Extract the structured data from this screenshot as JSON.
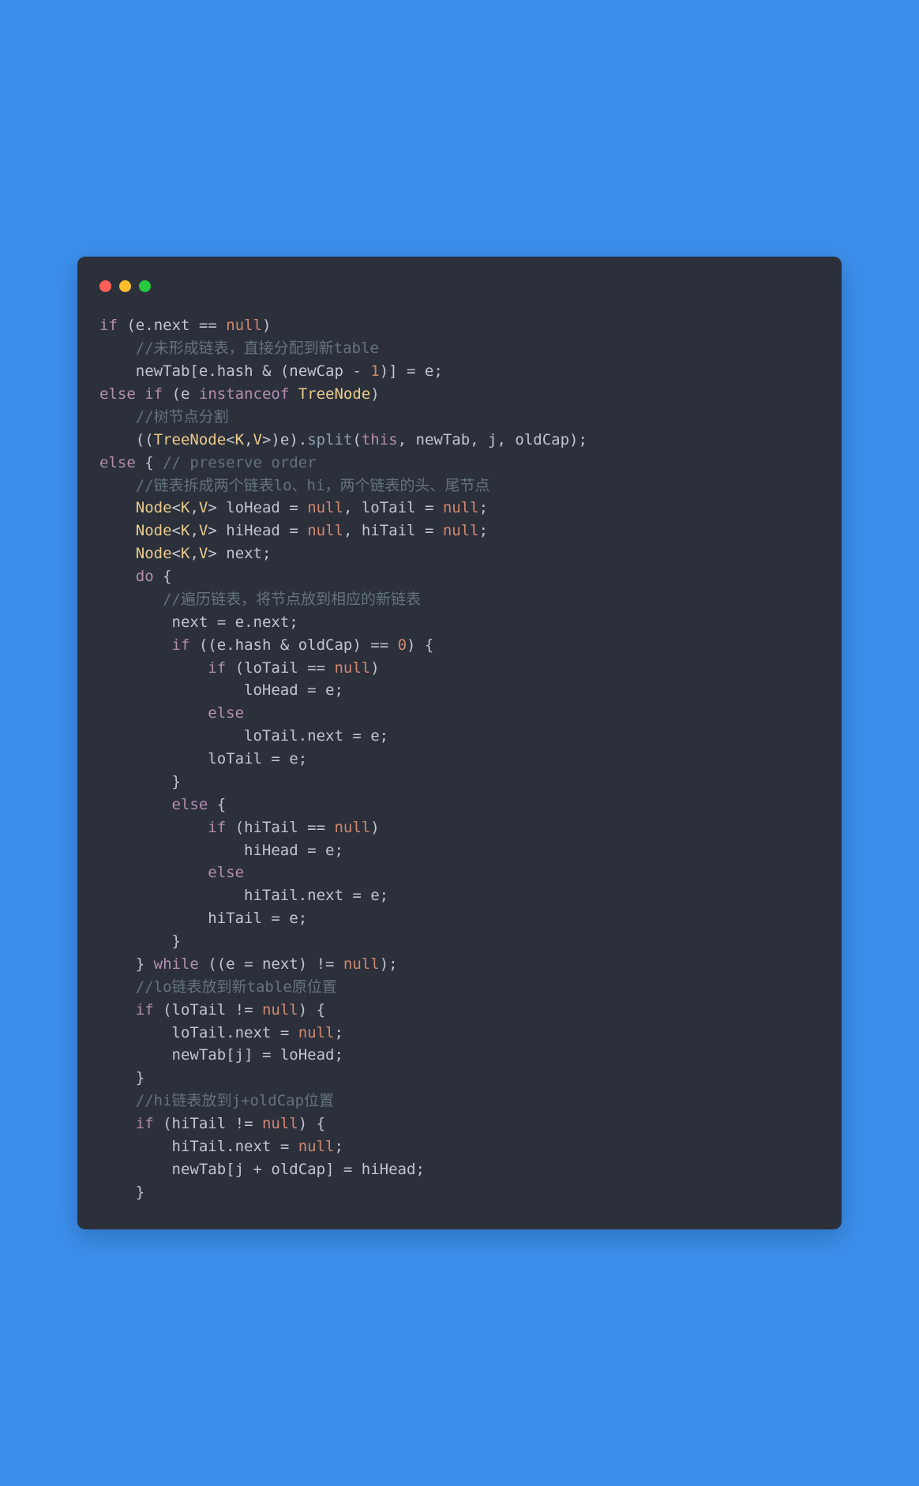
{
  "colors": {
    "background_page": "#3b8eea",
    "background_window": "#2b303b",
    "text_default": "#c0c5ce",
    "keyword": "#b48ead",
    "literal": "#d08770",
    "comment": "#65737e",
    "function": "#8fa1b3",
    "class": "#ebcb8b",
    "dot_red": "#ff5f56",
    "dot_yellow": "#ffbd2e",
    "dot_green": "#27c93f"
  },
  "titlebar": {
    "dots": [
      "red",
      "yellow",
      "green"
    ]
  },
  "code": {
    "language": "java",
    "tokens": [
      [
        [
          "kw",
          "if"
        ],
        [
          "pn",
          " ("
        ],
        [
          "",
          "e"
        ],
        [
          "pn",
          "."
        ],
        [
          "",
          "next"
        ],
        [
          "pn",
          " == "
        ],
        [
          "lit",
          "null"
        ],
        [
          "pn",
          ")"
        ]
      ],
      [
        [
          "pn",
          "    "
        ],
        [
          "cmt",
          "//未形成链表，直接分配到新table"
        ]
      ],
      [
        [
          "pn",
          "    "
        ],
        [
          "",
          "newTab"
        ],
        [
          "pn",
          "["
        ],
        [
          "",
          "e"
        ],
        [
          "pn",
          "."
        ],
        [
          "",
          "hash"
        ],
        [
          "pn",
          " & ("
        ],
        [
          "",
          "newCap"
        ],
        [
          "pn",
          " - "
        ],
        [
          "lit",
          "1"
        ],
        [
          "pn",
          ")] = "
        ],
        [
          "",
          "e"
        ],
        [
          "pn",
          ";"
        ]
      ],
      [
        [
          "kw",
          "else if"
        ],
        [
          "pn",
          " ("
        ],
        [
          "",
          "e"
        ],
        [
          "pn",
          " "
        ],
        [
          "kw",
          "instanceof"
        ],
        [
          "pn",
          " "
        ],
        [
          "cls",
          "TreeNode"
        ],
        [
          "pn",
          ")"
        ]
      ],
      [
        [
          "pn",
          "    "
        ],
        [
          "cmt",
          "//树节点分割"
        ]
      ],
      [
        [
          "pn",
          "    (("
        ],
        [
          "cls",
          "TreeNode"
        ],
        [
          "pn",
          "<"
        ],
        [
          "cls",
          "K"
        ],
        [
          "pn",
          ","
        ],
        [
          "cls",
          "V"
        ],
        [
          "pn",
          ">)"
        ],
        [
          "",
          "e"
        ],
        [
          "pn",
          ")."
        ],
        [
          "fn",
          "split"
        ],
        [
          "pn",
          "("
        ],
        [
          "kw2",
          "this"
        ],
        [
          "pn",
          ", "
        ],
        [
          "",
          "newTab"
        ],
        [
          "pn",
          ", "
        ],
        [
          "",
          "j"
        ],
        [
          "pn",
          ", "
        ],
        [
          "",
          "oldCap"
        ],
        [
          "pn",
          ");"
        ]
      ],
      [
        [
          "kw",
          "else"
        ],
        [
          "pn",
          " { "
        ],
        [
          "cmt",
          "// preserve order"
        ]
      ],
      [
        [
          "pn",
          "    "
        ],
        [
          "cmt",
          "//链表拆成两个链表lo、hi，两个链表的头、尾节点"
        ]
      ],
      [
        [
          "pn",
          "    "
        ],
        [
          "cls",
          "Node"
        ],
        [
          "pn",
          "<"
        ],
        [
          "cls",
          "K"
        ],
        [
          "pn",
          ","
        ],
        [
          "cls",
          "V"
        ],
        [
          "pn",
          "> "
        ],
        [
          "",
          "loHead"
        ],
        [
          "pn",
          " = "
        ],
        [
          "lit",
          "null"
        ],
        [
          "pn",
          ", "
        ],
        [
          "",
          "loTail"
        ],
        [
          "pn",
          " = "
        ],
        [
          "lit",
          "null"
        ],
        [
          "pn",
          ";"
        ]
      ],
      [
        [
          "pn",
          "    "
        ],
        [
          "cls",
          "Node"
        ],
        [
          "pn",
          "<"
        ],
        [
          "cls",
          "K"
        ],
        [
          "pn",
          ","
        ],
        [
          "cls",
          "V"
        ],
        [
          "pn",
          "> "
        ],
        [
          "",
          "hiHead"
        ],
        [
          "pn",
          " = "
        ],
        [
          "lit",
          "null"
        ],
        [
          "pn",
          ", "
        ],
        [
          "",
          "hiTail"
        ],
        [
          "pn",
          " = "
        ],
        [
          "lit",
          "null"
        ],
        [
          "pn",
          ";"
        ]
      ],
      [
        [
          "pn",
          "    "
        ],
        [
          "cls",
          "Node"
        ],
        [
          "pn",
          "<"
        ],
        [
          "cls",
          "K"
        ],
        [
          "pn",
          ","
        ],
        [
          "cls",
          "V"
        ],
        [
          "pn",
          "> "
        ],
        [
          "",
          "next"
        ],
        [
          "pn",
          ";"
        ]
      ],
      [
        [
          "pn",
          "    "
        ],
        [
          "kw",
          "do"
        ],
        [
          "pn",
          " {"
        ]
      ],
      [
        [
          "pn",
          "       "
        ],
        [
          "cmt",
          "//遍历链表，将节点放到相应的新链表"
        ]
      ],
      [
        [
          "pn",
          "        "
        ],
        [
          "",
          "next"
        ],
        [
          "pn",
          " = "
        ],
        [
          "",
          "e"
        ],
        [
          "pn",
          "."
        ],
        [
          "",
          "next"
        ],
        [
          "pn",
          ";"
        ]
      ],
      [
        [
          "pn",
          "        "
        ],
        [
          "kw",
          "if"
        ],
        [
          "pn",
          " (("
        ],
        [
          "",
          "e"
        ],
        [
          "pn",
          "."
        ],
        [
          "",
          "hash"
        ],
        [
          "pn",
          " & "
        ],
        [
          "",
          "oldCap"
        ],
        [
          "pn",
          ") == "
        ],
        [
          "lit",
          "0"
        ],
        [
          "pn",
          ") {"
        ]
      ],
      [
        [
          "pn",
          "            "
        ],
        [
          "kw",
          "if"
        ],
        [
          "pn",
          " ("
        ],
        [
          "",
          "loTail"
        ],
        [
          "pn",
          " == "
        ],
        [
          "lit",
          "null"
        ],
        [
          "pn",
          ")"
        ]
      ],
      [
        [
          "pn",
          "                "
        ],
        [
          "",
          "loHead"
        ],
        [
          "pn",
          " = "
        ],
        [
          "",
          "e"
        ],
        [
          "pn",
          ";"
        ]
      ],
      [
        [
          "pn",
          "            "
        ],
        [
          "kw",
          "else"
        ]
      ],
      [
        [
          "pn",
          "                "
        ],
        [
          "",
          "loTail"
        ],
        [
          "pn",
          "."
        ],
        [
          "",
          "next"
        ],
        [
          "pn",
          " = "
        ],
        [
          "",
          "e"
        ],
        [
          "pn",
          ";"
        ]
      ],
      [
        [
          "pn",
          "            "
        ],
        [
          "",
          "loTail"
        ],
        [
          "pn",
          " = "
        ],
        [
          "",
          "e"
        ],
        [
          "pn",
          ";"
        ]
      ],
      [
        [
          "pn",
          "        }"
        ]
      ],
      [
        [
          "pn",
          "        "
        ],
        [
          "kw",
          "else"
        ],
        [
          "pn",
          " {"
        ]
      ],
      [
        [
          "pn",
          "            "
        ],
        [
          "kw",
          "if"
        ],
        [
          "pn",
          " ("
        ],
        [
          "",
          "hiTail"
        ],
        [
          "pn",
          " == "
        ],
        [
          "lit",
          "null"
        ],
        [
          "pn",
          ")"
        ]
      ],
      [
        [
          "pn",
          "                "
        ],
        [
          "",
          "hiHead"
        ],
        [
          "pn",
          " = "
        ],
        [
          "",
          "e"
        ],
        [
          "pn",
          ";"
        ]
      ],
      [
        [
          "pn",
          "            "
        ],
        [
          "kw",
          "else"
        ]
      ],
      [
        [
          "pn",
          "                "
        ],
        [
          "",
          "hiTail"
        ],
        [
          "pn",
          "."
        ],
        [
          "",
          "next"
        ],
        [
          "pn",
          " = "
        ],
        [
          "",
          "e"
        ],
        [
          "pn",
          ";"
        ]
      ],
      [
        [
          "pn",
          "            "
        ],
        [
          "",
          "hiTail"
        ],
        [
          "pn",
          " = "
        ],
        [
          "",
          "e"
        ],
        [
          "pn",
          ";"
        ]
      ],
      [
        [
          "pn",
          "        }"
        ]
      ],
      [
        [
          "pn",
          "    } "
        ],
        [
          "kw",
          "while"
        ],
        [
          "pn",
          " (("
        ],
        [
          "",
          "e"
        ],
        [
          "pn",
          " = "
        ],
        [
          "",
          "next"
        ],
        [
          "pn",
          ") != "
        ],
        [
          "lit",
          "null"
        ],
        [
          "pn",
          ");"
        ]
      ],
      [
        [
          "pn",
          "    "
        ],
        [
          "cmt",
          "//lo链表放到新table原位置"
        ]
      ],
      [
        [
          "pn",
          "    "
        ],
        [
          "kw",
          "if"
        ],
        [
          "pn",
          " ("
        ],
        [
          "",
          "loTail"
        ],
        [
          "pn",
          " != "
        ],
        [
          "lit",
          "null"
        ],
        [
          "pn",
          ") {"
        ]
      ],
      [
        [
          "pn",
          "        "
        ],
        [
          "",
          "loTail"
        ],
        [
          "pn",
          "."
        ],
        [
          "",
          "next"
        ],
        [
          "pn",
          " = "
        ],
        [
          "lit",
          "null"
        ],
        [
          "pn",
          ";"
        ]
      ],
      [
        [
          "pn",
          "        "
        ],
        [
          "",
          "newTab"
        ],
        [
          "pn",
          "["
        ],
        [
          "",
          "j"
        ],
        [
          "pn",
          "] = "
        ],
        [
          "",
          "loHead"
        ],
        [
          "pn",
          ";"
        ]
      ],
      [
        [
          "pn",
          "    }"
        ]
      ],
      [
        [
          "pn",
          "    "
        ],
        [
          "cmt",
          "//hi链表放到j+oldCap位置"
        ]
      ],
      [
        [
          "pn",
          "    "
        ],
        [
          "kw",
          "if"
        ],
        [
          "pn",
          " ("
        ],
        [
          "",
          "hiTail"
        ],
        [
          "pn",
          " != "
        ],
        [
          "lit",
          "null"
        ],
        [
          "pn",
          ") {"
        ]
      ],
      [
        [
          "pn",
          "        "
        ],
        [
          "",
          "hiTail"
        ],
        [
          "pn",
          "."
        ],
        [
          "",
          "next"
        ],
        [
          "pn",
          " = "
        ],
        [
          "lit",
          "null"
        ],
        [
          "pn",
          ";"
        ]
      ],
      [
        [
          "pn",
          "        "
        ],
        [
          "",
          "newTab"
        ],
        [
          "pn",
          "["
        ],
        [
          "",
          "j"
        ],
        [
          "pn",
          " + "
        ],
        [
          "",
          "oldCap"
        ],
        [
          "pn",
          "] = "
        ],
        [
          "",
          "hiHead"
        ],
        [
          "pn",
          ";"
        ]
      ],
      [
        [
          "pn",
          "    }"
        ]
      ]
    ]
  }
}
